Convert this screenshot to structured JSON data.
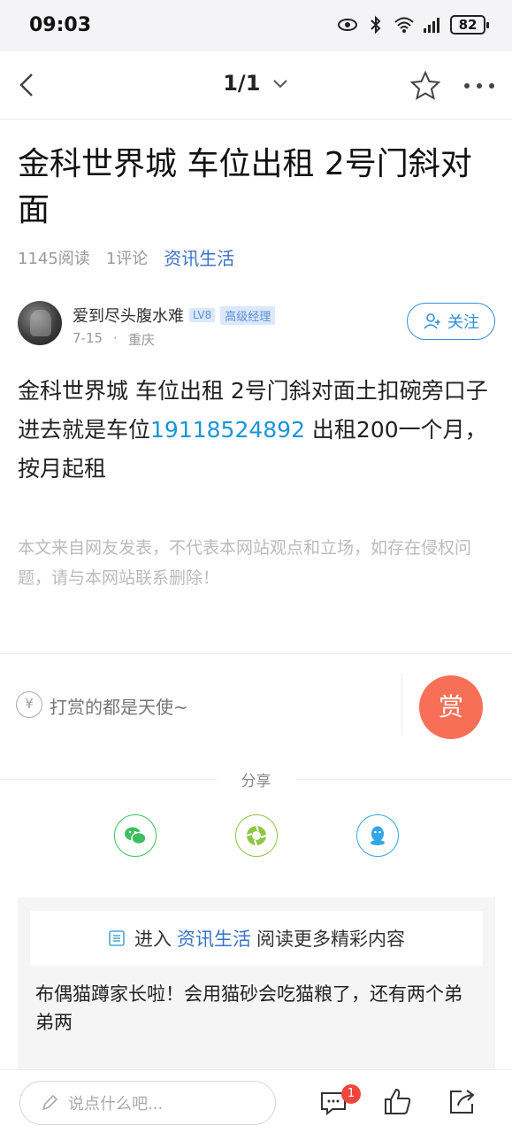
{
  "status": {
    "time": "09:03",
    "battery": "82"
  },
  "nav": {
    "pager": "1/1"
  },
  "article": {
    "title": "金科世界城 车位出租 2号门斜对面",
    "reads": "1145阅读",
    "comments": "1评论",
    "category": "资讯生活",
    "body_prefix": "金科世界城 车位出租 2号门斜对面土扣碗旁口子进去就是车位",
    "body_phone": "19118524892",
    "body_suffix": " 出租200一个月，按月起租",
    "disclaimer": "本文来自网友发表，不代表本网站观点和立场，如存在侵权问题，请与本网站联系删除！"
  },
  "author": {
    "name": "爱到尽头腹水难",
    "level": "LV8",
    "rank": "高级经理",
    "date": "7-15",
    "location": "重庆",
    "follow_label": "关注"
  },
  "tip": {
    "icon_text": "¥",
    "text": "打赏的都是天使~",
    "button": "赏"
  },
  "share": {
    "label": "分享",
    "targets": [
      "wechat-icon",
      "moments-icon",
      "qq-icon"
    ]
  },
  "recommend": {
    "enter": "进入",
    "category": "资讯生活",
    "more": "阅读更多精彩内容",
    "item_title": "布偶猫蹲家长啦！会用猫砂会吃猫粮了，还有两个弟弟两"
  },
  "bottom": {
    "placeholder": "说点什么吧...",
    "comment_badge": "1"
  },
  "colors": {
    "accent": "#3a72c6",
    "phone": "#1a95d6",
    "tip_button": "#f86f58",
    "follow": "#2f8fd8"
  }
}
